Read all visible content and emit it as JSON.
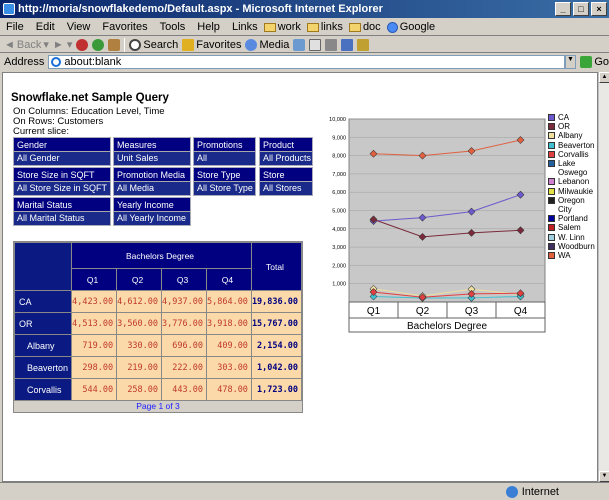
{
  "window": {
    "title": "http://moria/snowflakedemo/Default.aspx - Microsoft Internet Explorer"
  },
  "menu": [
    "File",
    "Edit",
    "View",
    "Favorites",
    "Tools",
    "Help"
  ],
  "links": {
    "label": "Links",
    "items": [
      "work",
      "links",
      "doc",
      "Google"
    ]
  },
  "toolbar": {
    "back": "Back",
    "search": "Search",
    "favorites": "Favorites",
    "media": "Media"
  },
  "address": {
    "label": "Address",
    "value": "about:blank",
    "go": "Go"
  },
  "status": {
    "zone": "Internet"
  },
  "page": {
    "title": "Snowflake.net Sample Query",
    "columns": "On Columns: Education Level, Time",
    "rows": "On Rows: Customers",
    "slice": "Current slice:",
    "slicers": [
      {
        "h": "Gender",
        "v": "All Gender"
      },
      {
        "h": "Measures",
        "v": "Unit Sales"
      },
      {
        "h": "Promotions",
        "v": "All Promotions"
      },
      {
        "h": "Product",
        "v": "All Products"
      },
      {
        "h": "Store Size in SQFT",
        "v": "All Store Size in SQFT"
      },
      {
        "h": "Promotion Media",
        "v": "All Media"
      },
      {
        "h": "Store Type",
        "v": "All Store Type"
      },
      {
        "h": "Store",
        "v": "All Stores"
      },
      {
        "h": "Marital Status",
        "v": "All Marital Status"
      },
      {
        "h": "Yearly Income",
        "v": "All Yearly Income"
      }
    ],
    "grid": {
      "group": "Bachelors Degree",
      "total": "Total",
      "quarters": [
        "Q1",
        "Q2",
        "Q3",
        "Q4"
      ],
      "rows": [
        {
          "name": "CA",
          "child": false,
          "values": [
            "4,423.00",
            "4,612.00",
            "4,937.00",
            "5,864.00"
          ],
          "total": "19,836.00"
        },
        {
          "name": "OR",
          "child": false,
          "values": [
            "4,513.00",
            "3,560.00",
            "3,776.00",
            "3,918.00"
          ],
          "total": "15,767.00"
        },
        {
          "name": "Albany",
          "child": true,
          "values": [
            "719.00",
            "330.00",
            "696.00",
            "409.00"
          ],
          "total": "2,154.00"
        },
        {
          "name": "Beaverton",
          "child": true,
          "values": [
            "298.00",
            "219.00",
            "222.00",
            "303.00"
          ],
          "total": "1,042.00"
        },
        {
          "name": "Corvallis",
          "child": true,
          "values": [
            "544.00",
            "258.00",
            "443.00",
            "478.00"
          ],
          "total": "1,723.00"
        }
      ],
      "pager": "Page 1 of 3"
    }
  },
  "chart_data": {
    "type": "line",
    "categories": [
      "Q1",
      "Q2",
      "Q3",
      "Q4"
    ],
    "xlabel": "Bachelors Degree",
    "ylim": [
      0,
      10000
    ],
    "yticks": [
      "10,000",
      "9,000",
      "8,000",
      "7,000",
      "6,000",
      "5,000",
      "4,000",
      "3,000",
      "2,000",
      "1,000"
    ],
    "series": [
      {
        "name": "CA",
        "color": "#6a5acd",
        "values": [
          4423,
          4612,
          4937,
          5864
        ]
      },
      {
        "name": "OR",
        "color": "#7a2a3a",
        "values": [
          4513,
          3560,
          3776,
          3918
        ]
      },
      {
        "name": "Albany",
        "color": "#f0e0a0",
        "values": [
          719,
          330,
          696,
          409
        ]
      },
      {
        "name": "Beaverton",
        "color": "#40c0d0",
        "values": [
          298,
          219,
          222,
          303
        ]
      },
      {
        "name": "Corvallis",
        "color": "#e04040",
        "values": [
          544,
          258,
          443,
          478
        ]
      },
      {
        "name": "Lake Oswego",
        "color": "#2060a0",
        "values": [
          null,
          null,
          null,
          null
        ]
      },
      {
        "name": "Lebanon",
        "color": "#d080d0",
        "values": [
          null,
          null,
          null,
          null
        ]
      },
      {
        "name": "Milwaukie",
        "color": "#e0e040",
        "values": [
          null,
          null,
          null,
          null
        ]
      },
      {
        "name": "Oregon City",
        "color": "#202020",
        "values": [
          null,
          null,
          null,
          null
        ]
      },
      {
        "name": "Portland",
        "color": "#0000a0",
        "values": [
          null,
          null,
          null,
          null
        ]
      },
      {
        "name": "Salem",
        "color": "#c02020",
        "values": [
          null,
          null,
          null,
          null
        ]
      },
      {
        "name": "W. Linn",
        "color": "#a0d0e0",
        "values": [
          null,
          null,
          null,
          null
        ]
      },
      {
        "name": "Woodburn",
        "color": "#403060",
        "values": [
          null,
          null,
          null,
          null
        ]
      },
      {
        "name": "WA",
        "color": "#e06040",
        "values": [
          8100,
          8000,
          8250,
          8850
        ]
      }
    ]
  }
}
